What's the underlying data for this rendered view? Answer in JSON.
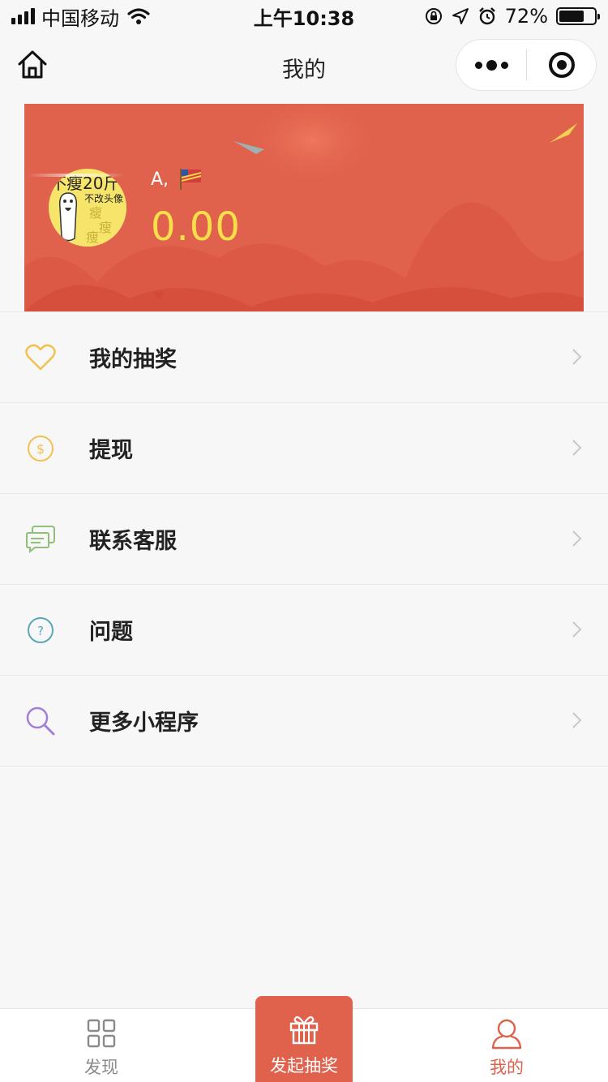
{
  "status_bar": {
    "carrier": "中国移动",
    "time": "上午10:38",
    "battery": "72%",
    "battery_level": 0.72
  },
  "nav": {
    "title": "我的"
  },
  "profile": {
    "username": "A,",
    "balance": "0.00",
    "avatar_text": "不瘦20斤",
    "avatar_subtext": "不改头像"
  },
  "menu": {
    "items": [
      {
        "label": "我的抽奖",
        "icon": "heart-icon",
        "color": "#f2c14e"
      },
      {
        "label": "提现",
        "icon": "coin-icon",
        "color": "#f2c14e"
      },
      {
        "label": "联系客服",
        "icon": "chat-icon",
        "color": "#8fbf7a"
      },
      {
        "label": "问题",
        "icon": "question-icon",
        "color": "#5aa7b5"
      },
      {
        "label": "更多小程序",
        "icon": "search-icon",
        "color": "#a37ed6"
      }
    ]
  },
  "tabbar": {
    "discover": "发现",
    "create": "发起抽奖",
    "me": "我的"
  },
  "colors": {
    "accent": "#e0614c",
    "balance": "#f7df4a",
    "inactive_tab": "#8a8a8a"
  }
}
